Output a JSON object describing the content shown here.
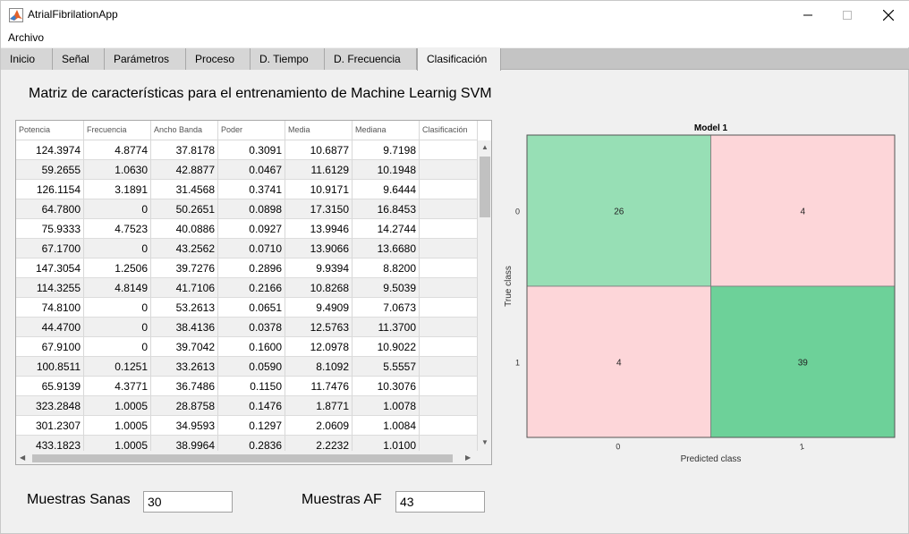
{
  "window": {
    "title": "AtrialFibrilationApp"
  },
  "menu": {
    "archivo": "Archivo"
  },
  "tabs": [
    {
      "label": "Inicio"
    },
    {
      "label": "Señal"
    },
    {
      "label": "Parámetros"
    },
    {
      "label": "Proceso"
    },
    {
      "label": "D. Tiempo"
    },
    {
      "label": "D. Frecuencia"
    },
    {
      "label": "Clasificación"
    }
  ],
  "active_tab": "Clasificación",
  "heading": "Matriz de características para el entrenamiento de Machine Learnig SVM",
  "table": {
    "columns": [
      "Potencia",
      "Frecuencia",
      "Ancho Banda",
      "Poder",
      "Media",
      "Mediana",
      "Clasificación"
    ],
    "rows": [
      [
        "124.3974",
        "4.8774",
        "37.8178",
        "0.3091",
        "10.6877",
        "9.7198",
        ""
      ],
      [
        "59.2655",
        "1.0630",
        "42.8877",
        "0.0467",
        "11.6129",
        "10.1948",
        ""
      ],
      [
        "126.1154",
        "3.1891",
        "31.4568",
        "0.3741",
        "10.9171",
        "9.6444",
        ""
      ],
      [
        "64.7800",
        "0",
        "50.2651",
        "0.0898",
        "17.3150",
        "16.8453",
        ""
      ],
      [
        "75.9333",
        "4.7523",
        "40.0886",
        "0.0927",
        "13.9946",
        "14.2744",
        ""
      ],
      [
        "67.1700",
        "0",
        "43.2562",
        "0.0710",
        "13.9066",
        "13.6680",
        ""
      ],
      [
        "147.3054",
        "1.2506",
        "39.7276",
        "0.2896",
        "9.9394",
        "8.8200",
        ""
      ],
      [
        "114.3255",
        "4.8149",
        "41.7106",
        "0.2166",
        "10.8268",
        "9.5039",
        ""
      ],
      [
        "74.8100",
        "0",
        "53.2613",
        "0.0651",
        "9.4909",
        "7.0673",
        ""
      ],
      [
        "44.4700",
        "0",
        "38.4136",
        "0.0378",
        "12.5763",
        "11.3700",
        ""
      ],
      [
        "67.9100",
        "0",
        "39.7042",
        "0.1600",
        "12.0978",
        "10.9022",
        ""
      ],
      [
        "100.8511",
        "0.1251",
        "33.2613",
        "0.0590",
        "8.1092",
        "5.5557",
        ""
      ],
      [
        "65.9139",
        "4.3771",
        "36.7486",
        "0.1150",
        "11.7476",
        "10.3076",
        ""
      ],
      [
        "323.2848",
        "1.0005",
        "28.8758",
        "0.1476",
        "1.8771",
        "1.0078",
        ""
      ],
      [
        "301.2307",
        "1.0005",
        "34.9593",
        "0.1297",
        "2.0609",
        "1.0084",
        ""
      ],
      [
        "433.1823",
        "1.0005",
        "38.9964",
        "0.2836",
        "2.2232",
        "1.0100",
        ""
      ]
    ]
  },
  "chart_data": {
    "type": "heatmap",
    "title": "Model 1",
    "xlabel": "Predicted class",
    "ylabel": "True class",
    "x_categories": [
      "0",
      "1"
    ],
    "y_categories": [
      "0",
      "1"
    ],
    "values": [
      [
        26,
        4
      ],
      [
        4,
        39
      ]
    ],
    "colors": {
      "correct_light": "#97dfb5",
      "correct_dark": "#6dd199",
      "incorrect": "#fdd6d9"
    }
  },
  "footer": {
    "sanas_label": "Muestras Sanas",
    "sanas_value": "30",
    "af_label": "Muestras AF",
    "af_value": "43"
  }
}
